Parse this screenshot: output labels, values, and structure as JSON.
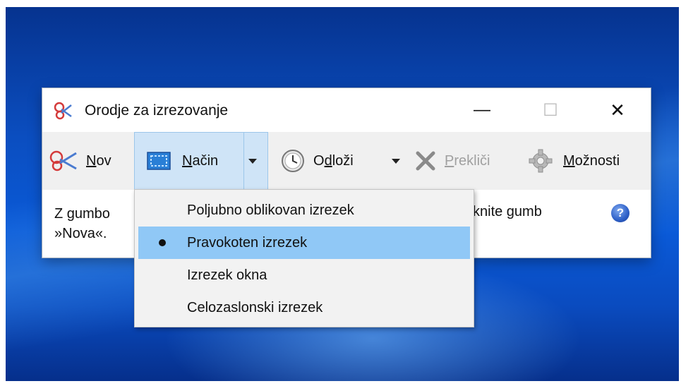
{
  "window": {
    "title": "Orodje za izrezovanje",
    "minimize_glyph": "—",
    "maximize_glyph": "☐",
    "close_glyph": "✕"
  },
  "toolbar": {
    "new": {
      "u": "N",
      "rest": "ov",
      "icon": "snipping-scissors-icon"
    },
    "mode": {
      "u": "N",
      "rest": "ačin",
      "icon": "rectangle-snip-icon"
    },
    "delay": {
      "pre": "O",
      "u": "d",
      "rest": "loži",
      "icon": "clock-icon"
    },
    "cancel": {
      "u": "P",
      "rest": "rekliči",
      "icon": "x-icon"
    },
    "options": {
      "u": "M",
      "rest": "ožnosti",
      "icon": "gear-icon"
    }
  },
  "content": {
    "instruction_start": "Z gumbo",
    "instruction_line2": "»Nova«.",
    "instruction_end": "knite gumb",
    "help_glyph": "?"
  },
  "mode_menu": {
    "items": [
      {
        "label": "Poljubno oblikovan izrezek",
        "selected": false
      },
      {
        "label": "Pravokoten izrezek",
        "selected": true
      },
      {
        "label": "Izrezek okna",
        "selected": false
      },
      {
        "label": "Celozaslonski izrezek",
        "selected": false
      }
    ]
  },
  "colors": {
    "desktop": "#0b4ec0",
    "menu_highlight": "#90c8f6",
    "mode_button": "#cfe4f7"
  }
}
